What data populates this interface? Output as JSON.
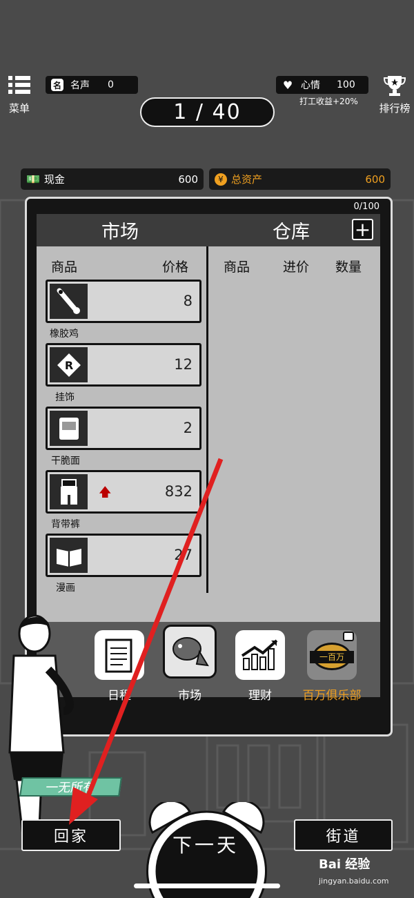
{
  "top": {
    "menu_label": "菜单",
    "leaderboard_label": "排行榜",
    "reputation_label": "名声",
    "reputation_value": "0",
    "mood_label": "心情",
    "mood_value": "100",
    "bonus_text": "打工收益+20%",
    "day_counter": "1 / 40"
  },
  "finance": {
    "cash_label": "现金",
    "cash_value": "600",
    "assets_label": "总资产",
    "assets_value": "600",
    "assets_color": "#f0a020"
  },
  "panel": {
    "capacity": "0/100",
    "market_title": "市场",
    "warehouse_title": "仓库",
    "add_label": "+",
    "market_columns": [
      "商品",
      "价格"
    ],
    "warehouse_columns": [
      "商品",
      "进价",
      "数量"
    ]
  },
  "market_items": [
    {
      "name": "橡胶鸡",
      "price": "8",
      "icon": "rubber-chicken-icon",
      "trend": ""
    },
    {
      "name": "挂饰",
      "price": "12",
      "icon": "pendant-icon",
      "trend": ""
    },
    {
      "name": "干脆面",
      "price": "2",
      "icon": "noodles-icon",
      "trend": ""
    },
    {
      "name": "背带裤",
      "price": "832",
      "icon": "overalls-icon",
      "trend": "up"
    },
    {
      "name": "漫画",
      "price": "27",
      "icon": "comic-book-icon",
      "trend": ""
    }
  ],
  "dock": [
    {
      "label": "日程",
      "icon": "schedule-icon",
      "active": false,
      "locked": false
    },
    {
      "label": "市场",
      "icon": "fish-market-icon",
      "active": true,
      "locked": false
    },
    {
      "label": "理财",
      "icon": "chart-growth-icon",
      "active": false,
      "locked": false
    },
    {
      "label": "百万俱乐部",
      "icon": "million-club-icon",
      "active": false,
      "locked": true,
      "badge_text": "一百万",
      "label_color": "#f0a020"
    }
  ],
  "bottom": {
    "home_label": "回家",
    "next_day_label": "下一天",
    "street_label": "街道",
    "status_banner": "一无所有"
  },
  "watermark": {
    "brand": "Bai 经验",
    "url": "jingyan.baidu.com"
  }
}
